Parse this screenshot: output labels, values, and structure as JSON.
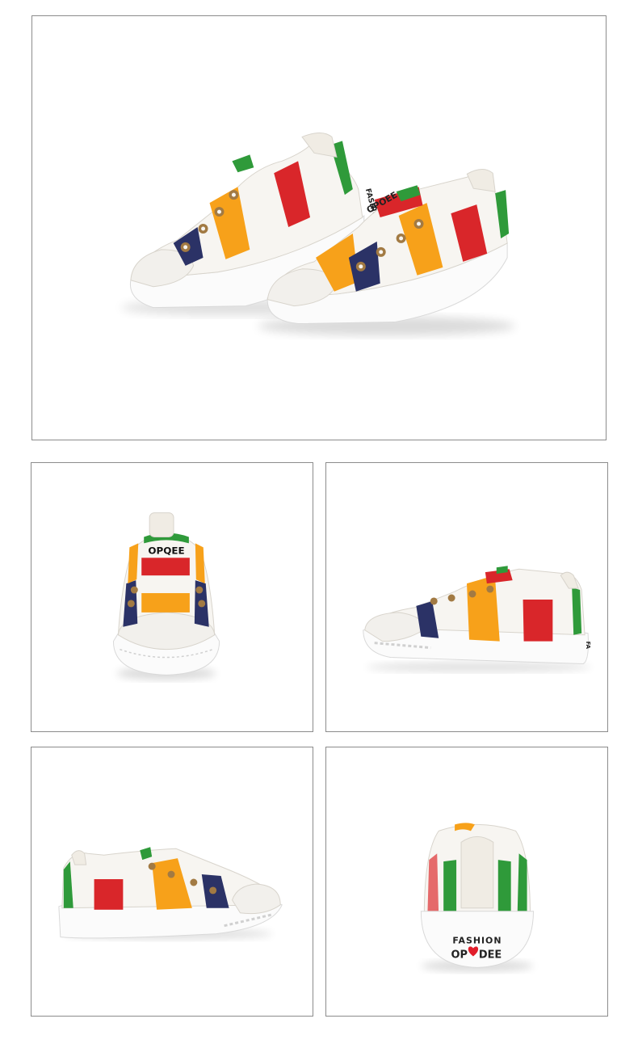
{
  "colors": {
    "frame_border": "#8c8c8c",
    "stripe_red": "#d9262a",
    "stripe_orange": "#f7a11a",
    "stripe_navy": "#2b3266",
    "stripe_green": "#2f9a3a",
    "canvas_white": "#f7f5f1",
    "sole_white": "#fbfbfb",
    "eyelet": "#a27a43",
    "heart": "#e11d2a"
  },
  "photos": {
    "main": {
      "view": "pair"
    },
    "front": {
      "view": "front",
      "tongue_label": "OPQEE"
    },
    "side": {
      "view": "outer-side",
      "heel_label": "FA"
    },
    "inner": {
      "view": "inner-side"
    },
    "back": {
      "view": "back",
      "heel_line1": "FASHION",
      "heel_line2_left": "OP",
      "heel_line2_right": "DEE"
    }
  },
  "main_sole_labels": {
    "left_shoe": "FASHIO",
    "right_shoe": "OPOEE"
  }
}
